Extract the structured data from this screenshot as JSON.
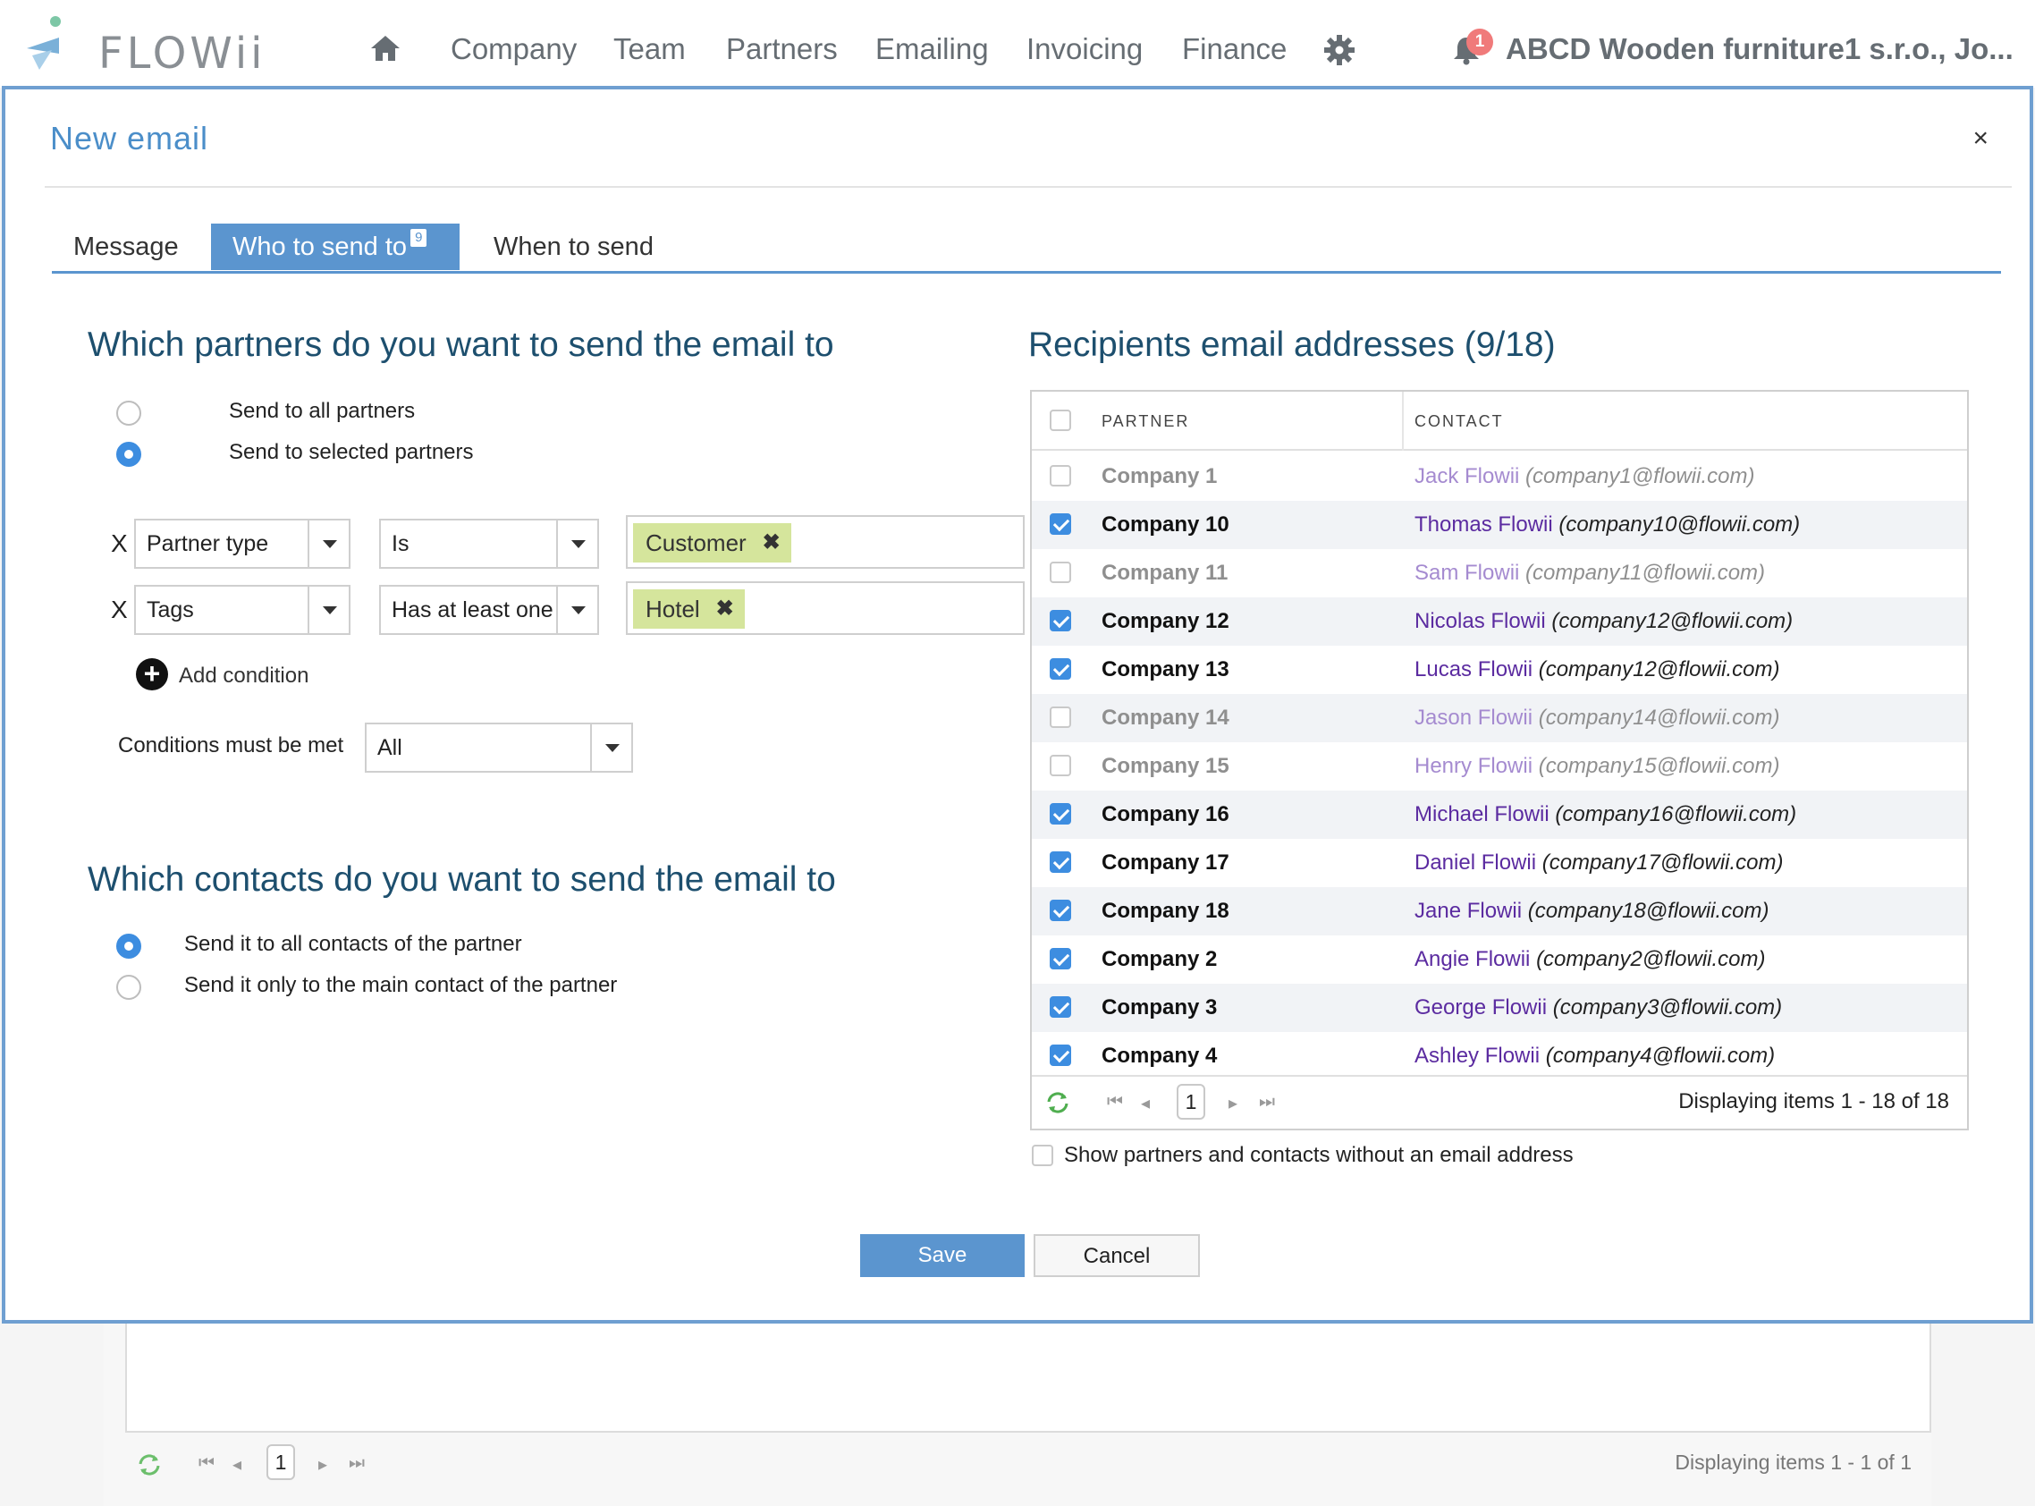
{
  "brand": {
    "name": "FLOWii"
  },
  "nav": {
    "items": [
      "Company",
      "Team",
      "Partners",
      "Emailing",
      "Invoicing",
      "Finance"
    ],
    "notification_count": "1",
    "company": "ABCD Wooden furniture1 s.r.o., Jo..."
  },
  "modal": {
    "title": "New email",
    "close": "×",
    "tabs": [
      {
        "label": "Message"
      },
      {
        "label": "Who to send to",
        "badge": "9"
      },
      {
        "label": "When to send"
      }
    ],
    "partners_section": {
      "title": "Which partners do you want to send the email to",
      "options": [
        "Send to all partners",
        "Send to selected partners"
      ],
      "selected_option": 1,
      "conditions": [
        {
          "remove": "X",
          "field": "Partner type",
          "operator": "Is",
          "value": "Customer"
        },
        {
          "remove": "X",
          "field": "Tags",
          "operator": "Has at least one",
          "value": "Hotel"
        }
      ],
      "add_condition": "Add condition",
      "conditions_met_label": "Conditions must be met",
      "conditions_met_value": "All"
    },
    "contacts_section": {
      "title": "Which contacts do you want to send the email to",
      "options": [
        "Send it to all contacts of the partner",
        "Send it only to the main contact of the partner"
      ],
      "selected_option": 0
    },
    "recipients": {
      "title": "Recipients email addresses (9/18)",
      "columns": [
        "PARTNER",
        "CONTACT"
      ],
      "rows": [
        {
          "partner": "Company 1",
          "name": "Jack Flowii",
          "email": "(company1@flowii.com)",
          "checked": false
        },
        {
          "partner": "Company 10",
          "name": "Thomas Flowii",
          "email": "(company10@flowii.com)",
          "checked": true
        },
        {
          "partner": "Company 11",
          "name": "Sam Flowii",
          "email": "(company11@flowii.com)",
          "checked": false
        },
        {
          "partner": "Company 12",
          "name": "Nicolas Flowii",
          "email": "(company12@flowii.com)",
          "checked": true
        },
        {
          "partner": "Company 13",
          "name": "Lucas Flowii",
          "email": "(company12@flowii.com)",
          "checked": true
        },
        {
          "partner": "Company 14",
          "name": "Jason Flowii",
          "email": "(company14@flowii.com)",
          "checked": false
        },
        {
          "partner": "Company 15",
          "name": "Henry Flowii",
          "email": "(company15@flowii.com)",
          "checked": false
        },
        {
          "partner": "Company 16",
          "name": "Michael Flowii",
          "email": "(company16@flowii.com)",
          "checked": true
        },
        {
          "partner": "Company 17",
          "name": "Daniel Flowii",
          "email": "(company17@flowii.com)",
          "checked": true
        },
        {
          "partner": "Company 18",
          "name": "Jane Flowii",
          "email": "(company18@flowii.com)",
          "checked": true
        },
        {
          "partner": "Company 2",
          "name": "Angie Flowii",
          "email": "(company2@flowii.com)",
          "checked": true
        },
        {
          "partner": "Company 3",
          "name": "George Flowii",
          "email": "(company3@flowii.com)",
          "checked": true
        },
        {
          "partner": "Company 4",
          "name": "Ashley Flowii",
          "email": "(company4@flowii.com)",
          "checked": true
        }
      ],
      "page": "1",
      "display": "Displaying items 1 - 18 of 18"
    },
    "show_without_email_label": "Show partners and contacts without an email address",
    "save": "Save",
    "cancel": "Cancel"
  },
  "background_list": {
    "page": "1",
    "display": "Displaying items 1 - 1 of 1"
  },
  "colors": {
    "accent": "#5b95cf",
    "title": "#1d4f6e",
    "tag": "#d5e59c",
    "contact_name": "#5b2ba0"
  }
}
